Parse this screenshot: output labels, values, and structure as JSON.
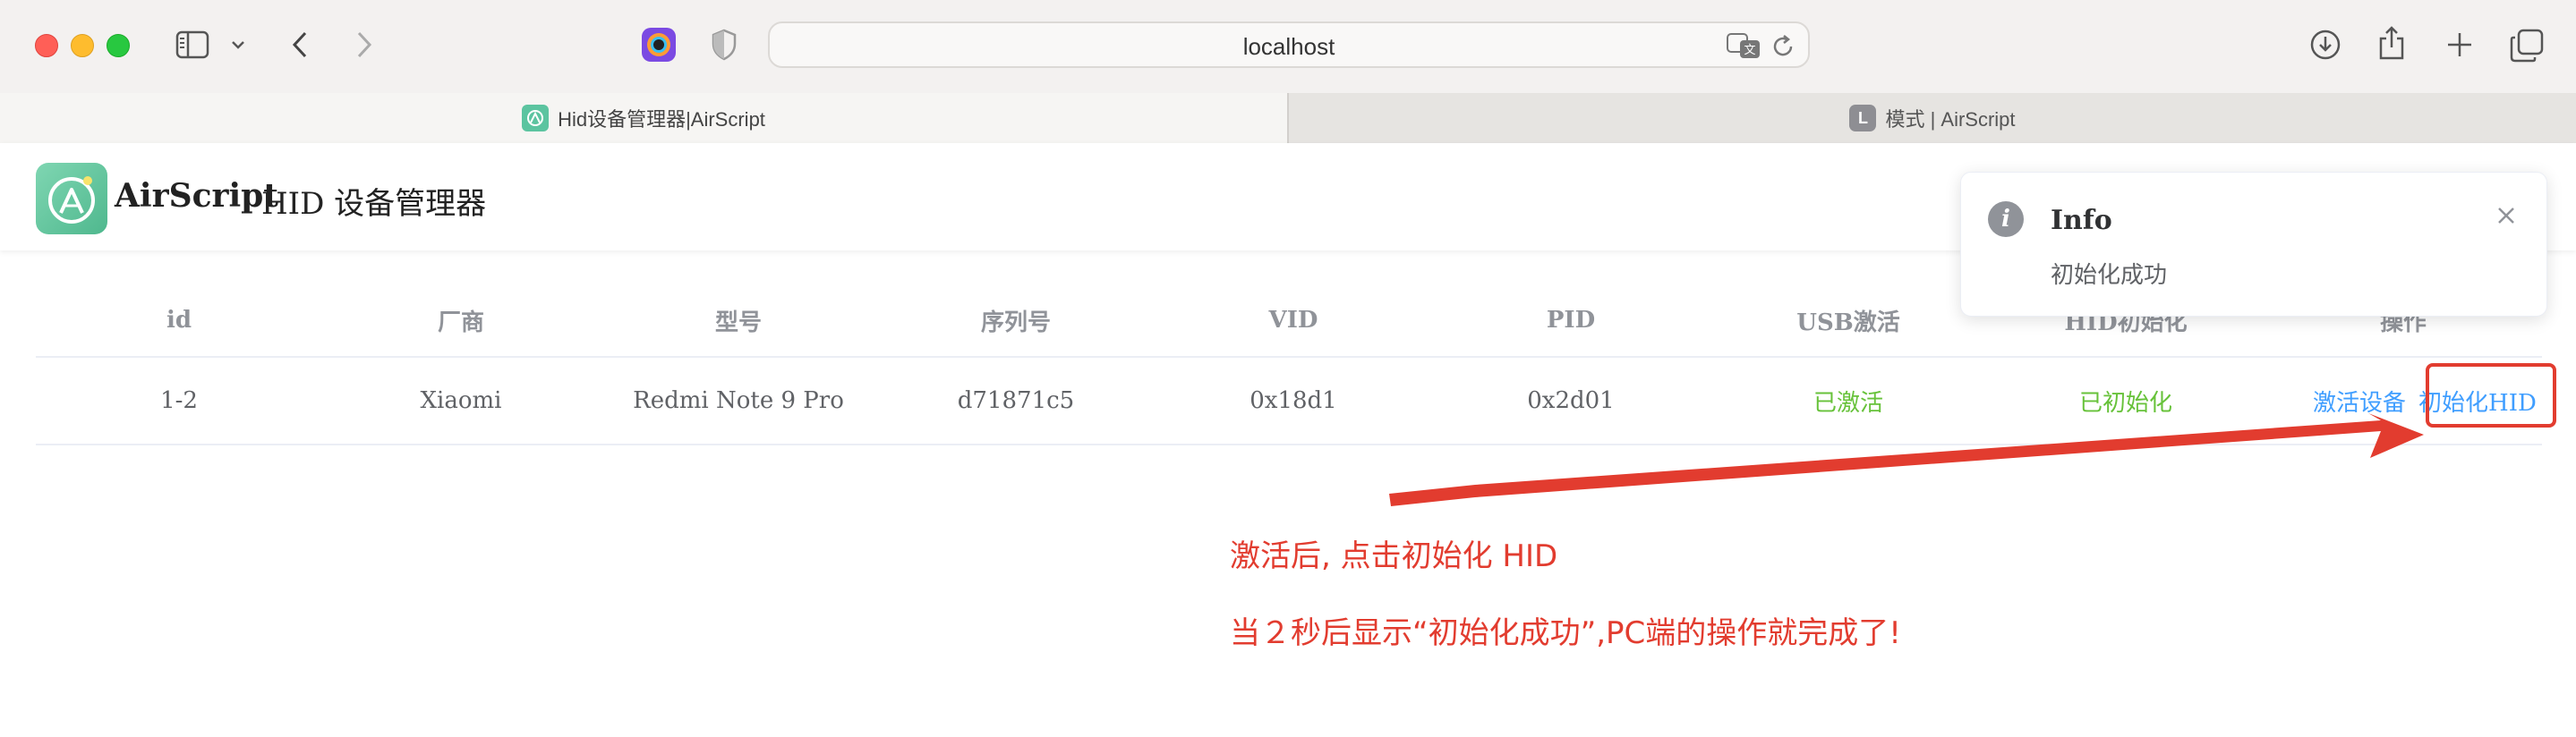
{
  "browser": {
    "url": "localhost",
    "tabs": [
      {
        "title": "Hid设备管理器|AirScript",
        "active": true,
        "favicon": "airscript-logo-icon"
      },
      {
        "title": "模式 | AirScript",
        "active": false,
        "favicon": "L"
      }
    ]
  },
  "header": {
    "brand": "AirScript",
    "title": "HID 设备管理器"
  },
  "table": {
    "columns": [
      "id",
      "厂商",
      "型号",
      "序列号",
      "VID",
      "PID",
      "USB激活",
      "HID初始化",
      "操作"
    ],
    "rows": [
      {
        "id": "1-2",
        "vendor": "Xiaomi",
        "model": "Redmi Note 9 Pro",
        "serial": "d71871c5",
        "vid": "0x18d1",
        "pid": "0x2d01",
        "usb_active": "已激活",
        "hid_init": "已初始化",
        "actions": [
          "激活设备",
          "初始化HID"
        ]
      }
    ]
  },
  "notification": {
    "type": "info",
    "title": "Info",
    "message": "初始化成功"
  },
  "annotations": {
    "line1": "激活后, 点击初始化 HID",
    "line2": "当２秒后显示“初始化成功”,PC端的操作就完成了!",
    "color": "#e23c2f"
  },
  "colors": {
    "success": "#67c23a",
    "link": "#409eff",
    "accent_red": "#e23c2f"
  }
}
